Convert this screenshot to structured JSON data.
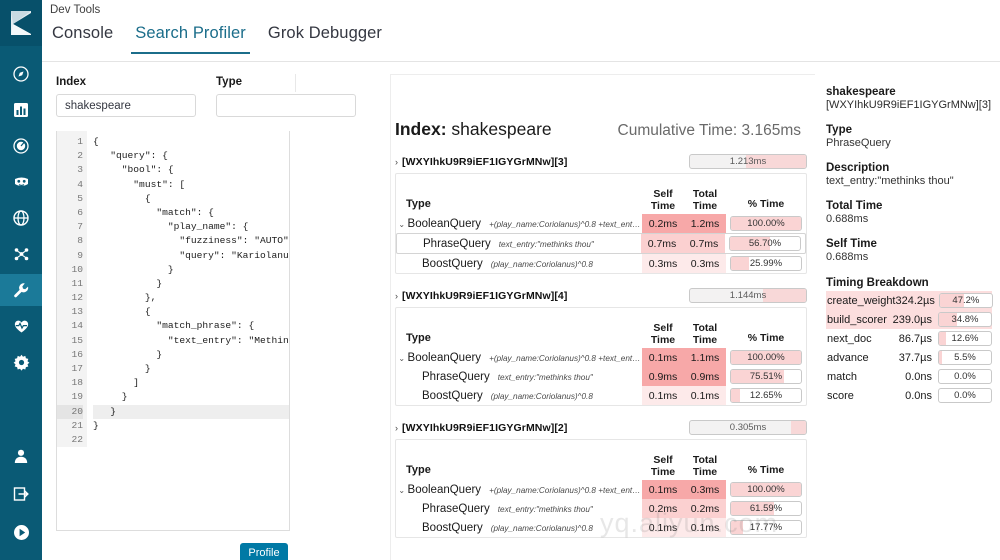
{
  "app": {
    "title": "Dev Tools",
    "tabs": [
      {
        "label": "Console",
        "active": false
      },
      {
        "label": "Search Profiler",
        "active": true
      },
      {
        "label": "Grok Debugger",
        "active": false
      }
    ]
  },
  "sidebar": {
    "logo": "kibana-logo",
    "items": [
      {
        "name": "discover",
        "icon": "compass-icon",
        "active": false
      },
      {
        "name": "visualize",
        "icon": "bar-chart-icon",
        "active": false
      },
      {
        "name": "dashboard",
        "icon": "dashboard-icon",
        "active": false
      },
      {
        "name": "timelion",
        "icon": "mask-icon",
        "active": false
      },
      {
        "name": "apm",
        "icon": "globe-icon",
        "active": false
      },
      {
        "name": "machine-learning",
        "icon": "ml-nodes-icon",
        "active": false
      },
      {
        "name": "dev-tools",
        "icon": "wrench-icon",
        "active": true
      },
      {
        "name": "monitoring",
        "icon": "heartbeat-icon",
        "active": false
      },
      {
        "name": "management",
        "icon": "gear-icon",
        "active": false
      }
    ],
    "bottom": [
      {
        "name": "user-account",
        "icon": "user-icon"
      },
      {
        "name": "logout",
        "icon": "logout-icon"
      },
      {
        "name": "collapse-nav",
        "icon": "play-circle-icon"
      }
    ]
  },
  "controls": {
    "index": {
      "label": "Index",
      "value": "shakespeare",
      "placeholder": ""
    },
    "type": {
      "label": "Type",
      "value": "",
      "placeholder": ""
    }
  },
  "editor": {
    "lines": [
      "{",
      "   \"query\": {",
      "     \"bool\": {",
      "       \"must\": [",
      "         {",
      "           \"match\": {",
      "             \"play_name\": {",
      "               \"fuzziness\": \"AUTO\",",
      "               \"query\": \"Kariolanus\"",
      "             }",
      "           }",
      "         },",
      "         {",
      "           \"match_phrase\": {",
      "             \"text_entry\": \"Methinks",
      "           }",
      "         }",
      "       ]",
      "     }",
      "   }",
      "}",
      ""
    ],
    "current_line": 20,
    "profile_button": "Profile"
  },
  "profiler": {
    "index_label": "Index:",
    "index_name": "shakespeare",
    "cumulative_label": "Cumulative Time:",
    "cumulative_value": "3.165ms",
    "columns": {
      "type": "Type",
      "self_time": "Self Time",
      "total_time": "Total Time",
      "pct_time": "% Time"
    },
    "shards": [
      {
        "id": "[WXYIhkU9R9iEF1IGYGrMNw][3]",
        "time": "1.213ms",
        "time_fill_pct": 52,
        "rows": [
          {
            "type": "BooleanQuery",
            "desc": "+(play_name:Coriolanus)^0.8 +text_entry:...",
            "self": "0.2ms",
            "total": "1.2ms",
            "pct": "100.00%",
            "pct_val": 100,
            "expandable": true,
            "selected": false,
            "indent": 0,
            "self_hl": "strong",
            "total_hl": "strong"
          },
          {
            "type": "PhraseQuery",
            "desc": "text_entry:\"methinks thou\"",
            "self": "0.7ms",
            "total": "0.7ms",
            "pct": "56.70%",
            "pct_val": 56.7,
            "expandable": false,
            "selected": true,
            "indent": 1,
            "self_hl": "mid",
            "total_hl": "mid"
          },
          {
            "type": "BoostQuery",
            "desc": "(play_name:Coriolanus)^0.8",
            "self": "0.3ms",
            "total": "0.3ms",
            "pct": "25.99%",
            "pct_val": 25.99,
            "expandable": false,
            "selected": false,
            "indent": 1,
            "self_hl": "light",
            "total_hl": "light"
          }
        ]
      },
      {
        "id": "[WXYIhkU9R9iEF1IGYGrMNw][4]",
        "time": "1.144ms",
        "time_fill_pct": 37,
        "rows": [
          {
            "type": "BooleanQuery",
            "desc": "+(play_name:Coriolanus)^0.8 +text_entry:...",
            "self": "0.1ms",
            "total": "1.1ms",
            "pct": "100.00%",
            "pct_val": 100,
            "expandable": true,
            "selected": false,
            "indent": 0,
            "self_hl": "strong",
            "total_hl": "strong"
          },
          {
            "type": "PhraseQuery",
            "desc": "text_entry:\"methinks thou\"",
            "self": "0.9ms",
            "total": "0.9ms",
            "pct": "75.51%",
            "pct_val": 75.51,
            "expandable": false,
            "selected": false,
            "indent": 1,
            "self_hl": "strong",
            "total_hl": "strong"
          },
          {
            "type": "BoostQuery",
            "desc": "(play_name:Coriolanus)^0.8",
            "self": "0.1ms",
            "total": "0.1ms",
            "pct": "12.65%",
            "pct_val": 12.65,
            "expandable": false,
            "selected": false,
            "indent": 1,
            "self_hl": "light",
            "total_hl": "light"
          }
        ]
      },
      {
        "id": "[WXYIhkU9R9iEF1IGYGrMNw][2]",
        "time": "0.305ms",
        "time_fill_pct": 13,
        "rows": [
          {
            "type": "BooleanQuery",
            "desc": "+(play_name:Coriolanus)^0.8 +text_entry:...",
            "self": "0.1ms",
            "total": "0.3ms",
            "pct": "100.00%",
            "pct_val": 100,
            "expandable": true,
            "selected": false,
            "indent": 0,
            "self_hl": "strong",
            "total_hl": "strong"
          },
          {
            "type": "PhraseQuery",
            "desc": "text_entry:\"methinks thou\"",
            "self": "0.2ms",
            "total": "0.2ms",
            "pct": "61.59%",
            "pct_val": 61.59,
            "expandable": false,
            "selected": false,
            "indent": 1,
            "self_hl": "mid",
            "total_hl": "mid"
          },
          {
            "type": "BoostQuery",
            "desc": "(play_name:Coriolanus)^0.8",
            "self": "0.1ms",
            "total": "0.1ms",
            "pct": "17.77%",
            "pct_val": 17.77,
            "expandable": false,
            "selected": false,
            "indent": 1,
            "self_hl": "light",
            "total_hl": "light"
          }
        ]
      }
    ]
  },
  "detail": {
    "index": "shakespeare",
    "shard": "[WXYIhkU9R9iEF1IGYGrMNw][3]",
    "type_label": "Type",
    "type_value": "PhraseQuery",
    "description_label": "Description",
    "description_value": "text_entry:\"methinks thou\"",
    "total_time_label": "Total Time",
    "total_time_value": "0.688ms",
    "self_time_label": "Self Time",
    "self_time_value": "0.688ms",
    "breakdown_label": "Timing Breakdown",
    "breakdown": [
      {
        "key": "create_weight",
        "value": "324.2µs",
        "pct": "47.2%",
        "pct_val": 47.2,
        "row_hl": "mid"
      },
      {
        "key": "build_scorer",
        "value": "239.0µs",
        "pct": "34.8%",
        "pct_val": 34.8,
        "row_hl": "mid"
      },
      {
        "key": "next_doc",
        "value": "86.7µs",
        "pct": "12.6%",
        "pct_val": 12.6,
        "row_hl": "none"
      },
      {
        "key": "advance",
        "value": "37.7µs",
        "pct": "5.5%",
        "pct_val": 5.5,
        "row_hl": "none"
      },
      {
        "key": "match",
        "value": "0.0ns",
        "pct": "0.0%",
        "pct_val": 0,
        "row_hl": "none"
      },
      {
        "key": "score",
        "value": "0.0ns",
        "pct": "0.0%",
        "pct_val": 0,
        "row_hl": "none"
      }
    ]
  },
  "watermark": "yq.aliyun.com",
  "colors": {
    "nav_bg": "#0a5a75",
    "nav_active": "#1b7a99",
    "tab_active": "#1b6d8a",
    "button_primary": "#0079a5",
    "heat_strong": "#f7a8a8",
    "heat_mid": "#fbd0d0",
    "heat_light": "#fdeaea",
    "pct_fill": "#fad4d4"
  }
}
